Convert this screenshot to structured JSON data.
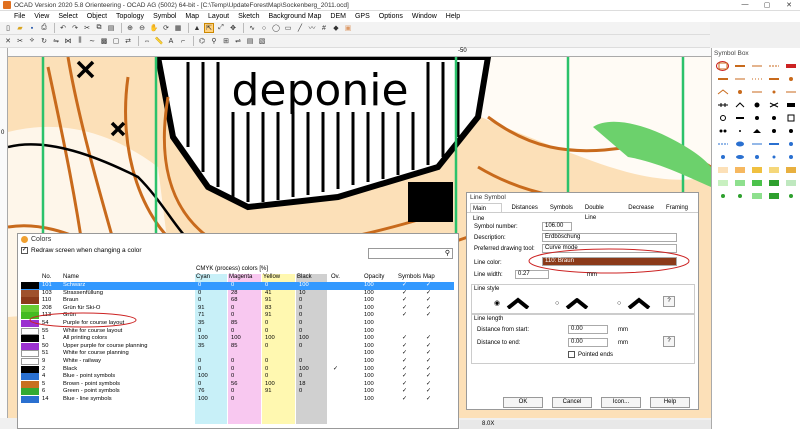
{
  "window": {
    "title": "OCAD Version 2020 5.8 Orienteering - OCAD AG (5002) 64-bit - [C:\\Temp\\UpdateForestMap\\Sockenberg_2011.ocd]",
    "controls": [
      "—",
      "▢",
      "✕"
    ]
  },
  "menu": [
    "File",
    "View",
    "Select",
    "Object",
    "Topology",
    "Symbol",
    "Map",
    "Layout",
    "Sketch",
    "Background Map",
    "DEM",
    "GPS",
    "Options",
    "Window",
    "Help"
  ],
  "ruler": {
    "top_mark": "-50",
    "left_mark": "0"
  },
  "map": {
    "label": "deponie"
  },
  "symbolbox": {
    "title": "Symbol Box"
  },
  "colors": {
    "title": "Colors",
    "redraw_label": "Redraw screen when changing a color",
    "redraw_checked": true,
    "cmyk_header": "CMYK (process) colors [%]",
    "columns": [
      "No.",
      "Name",
      "Cyan",
      "Magenta",
      "Yellow",
      "Black",
      "Ov.",
      "Opacity",
      "Symbols",
      "Map"
    ],
    "rows": [
      {
        "swatch": "#000000",
        "no": "101",
        "name": "Schwarz",
        "c": "0",
        "m": "0",
        "y": "0",
        "k": "100",
        "ov": "",
        "op": "100",
        "sym": "✓",
        "map": "✓",
        "selected": true
      },
      {
        "swatch": "#a0522d",
        "no": "103",
        "name": "Strassenfüllung",
        "c": "0",
        "m": "28",
        "y": "41",
        "k": "10",
        "ov": "",
        "op": "100",
        "sym": "✓",
        "map": "✓",
        "selected": false
      },
      {
        "swatch": "#8b3a1a",
        "no": "110",
        "name": "Braun",
        "c": "0",
        "m": "68",
        "y": "91",
        "k": "0",
        "ov": "",
        "op": "100",
        "sym": "✓",
        "map": "✓",
        "selected": false
      },
      {
        "swatch": "#66cc33",
        "no": "208",
        "name": "Grün für Ski-O",
        "c": "91",
        "m": "0",
        "y": "83",
        "k": "0",
        "ov": "",
        "op": "100",
        "sym": "✓",
        "map": "✓",
        "selected": false
      },
      {
        "swatch": "#44bb22",
        "no": "113",
        "name": "Grün",
        "c": "71",
        "m": "0",
        "y": "91",
        "k": "0",
        "ov": "",
        "op": "100",
        "sym": "✓",
        "map": "✓",
        "selected": false
      },
      {
        "swatch": "#9b30d0",
        "no": "54",
        "name": "Purple for course layout",
        "c": "35",
        "m": "85",
        "y": "0",
        "k": "0",
        "ov": "",
        "op": "100",
        "sym": "",
        "map": "",
        "selected": false
      },
      {
        "swatch": "#ffffff",
        "no": "55",
        "name": "White for course layout",
        "c": "0",
        "m": "0",
        "y": "0",
        "k": "0",
        "ov": "",
        "op": "100",
        "sym": "",
        "map": "",
        "selected": false
      },
      {
        "swatch": "#000000",
        "no": "1",
        "name": "All printing colors",
        "c": "100",
        "m": "100",
        "y": "100",
        "k": "100",
        "ov": "",
        "op": "100",
        "sym": "✓",
        "map": "✓",
        "selected": false
      },
      {
        "swatch": "#9b30d0",
        "no": "50",
        "name": "Upper purple for course planning",
        "c": "35",
        "m": "85",
        "y": "0",
        "k": "0",
        "ov": "",
        "op": "100",
        "sym": "✓",
        "map": "✓",
        "selected": false
      },
      {
        "swatch": "#ffffff",
        "no": "51",
        "name": "White for course planning",
        "c": "",
        "m": "",
        "y": "",
        "k": "",
        "ov": "",
        "op": "100",
        "sym": "✓",
        "map": "✓",
        "selected": false
      },
      {
        "swatch": "#ffffff",
        "no": "9",
        "name": "White - railway",
        "c": "0",
        "m": "0",
        "y": "0",
        "k": "0",
        "ov": "",
        "op": "100",
        "sym": "✓",
        "map": "✓",
        "selected": false
      },
      {
        "swatch": "#000000",
        "no": "2",
        "name": "Black",
        "c": "0",
        "m": "0",
        "y": "0",
        "k": "100",
        "ov": "✓",
        "op": "100",
        "sym": "✓",
        "map": "✓",
        "selected": false
      },
      {
        "swatch": "#2a70d0",
        "no": "4",
        "name": "Blue - point symbols",
        "c": "100",
        "m": "0",
        "y": "0",
        "k": "0",
        "ov": "",
        "op": "100",
        "sym": "✓",
        "map": "✓",
        "selected": false
      },
      {
        "swatch": "#c87020",
        "no": "5",
        "name": "Brown - point symbols",
        "c": "0",
        "m": "56",
        "y": "100",
        "k": "18",
        "ov": "",
        "op": "100",
        "sym": "✓",
        "map": "✓",
        "selected": false
      },
      {
        "swatch": "#33aa33",
        "no": "6",
        "name": "Green - point symbols",
        "c": "76",
        "m": "0",
        "y": "91",
        "k": "0",
        "ov": "",
        "op": "100",
        "sym": "✓",
        "map": "✓",
        "selected": false
      },
      {
        "swatch": "#2a70d0",
        "no": "14",
        "name": "Blue - line symbols",
        "c": "100",
        "m": "0",
        "y": "",
        "k": "",
        "ov": "",
        "op": "100",
        "sym": "✓",
        "map": "✓",
        "selected": false
      }
    ]
  },
  "line_symbol": {
    "title": "Line Symbol",
    "tabs": [
      "Main Line",
      "Distances",
      "Symbols",
      "Double Line",
      "Decrease",
      "Framing"
    ],
    "symbol_number_label": "Symbol number:",
    "symbol_number": "106.00",
    "description_label": "Description:",
    "description": "Erdböschung",
    "drawing_tool_label": "Preferred drawing tool:",
    "drawing_tool": "Curve mode",
    "line_color_label": "Line color:",
    "line_color": "110: Braun",
    "line_color_hex": "#8b3a1a",
    "line_width_label": "Line width:",
    "line_width": "0.27",
    "line_width_unit": "mm",
    "line_style_label": "Line style",
    "line_length_label": "Line length",
    "dist_start_label": "Distance from start:",
    "dist_start": "0.00",
    "dist_end_label": "Distance to end:",
    "dist_end": "0.00",
    "unit_mm": "mm",
    "pointed_ends_label": "Pointed ends",
    "help_mark": "?",
    "buttons": {
      "ok": "OK",
      "cancel": "Cancel",
      "icon": "Icon...",
      "help": "Help"
    }
  },
  "status": {
    "zoom": "8.0X"
  }
}
